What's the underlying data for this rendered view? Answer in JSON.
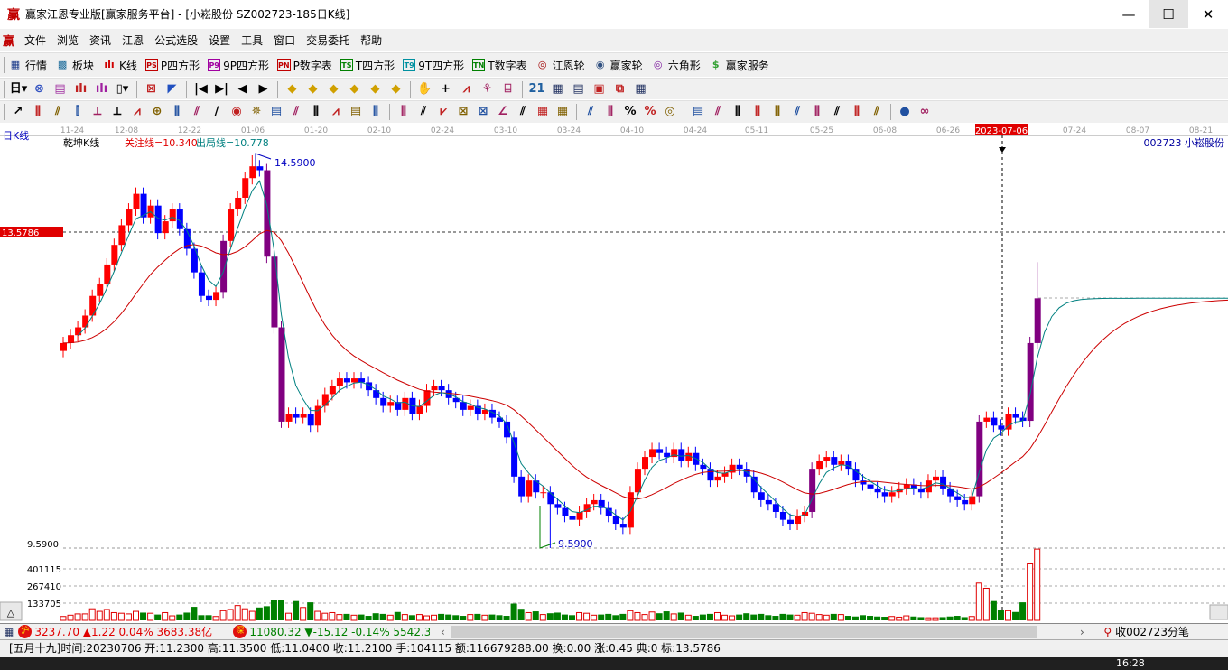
{
  "window": {
    "title": "赢家江恩专业版[赢家服务平台] - [小崧股份  SZ002723-185日K线]",
    "logo": "赢"
  },
  "menu": [
    "文件",
    "浏览",
    "资讯",
    "江恩",
    "公式选股",
    "设置",
    "工具",
    "窗口",
    "交易委托",
    "帮助"
  ],
  "toolbar1": [
    {
      "label": "行情",
      "icon": "▦",
      "color": "#1a3a8a",
      "name": "quote"
    },
    {
      "label": "板块",
      "icon": "▩",
      "color": "#1a6a9a",
      "name": "sector"
    },
    {
      "label": "K线",
      "icon": "ılı",
      "color": "#d00000",
      "name": "kline"
    },
    {
      "label": "P四方形",
      "icon": "PS",
      "color": "#c00000",
      "name": "p-square"
    },
    {
      "label": "9P四方形",
      "icon": "P9",
      "color": "#a000a0",
      "name": "9p-square"
    },
    {
      "label": "P数字表",
      "icon": "PN",
      "color": "#c00000",
      "name": "p-number-table"
    },
    {
      "label": "T四方形",
      "icon": "TS",
      "color": "#008000",
      "name": "t-square"
    },
    {
      "label": "9T四方形",
      "icon": "T9",
      "color": "#0090a0",
      "name": "9t-square"
    },
    {
      "label": "T数字表",
      "icon": "TN",
      "color": "#008000",
      "name": "t-number-table"
    },
    {
      "label": "江恩轮",
      "icon": "◎",
      "color": "#a00000",
      "name": "gann-wheel"
    },
    {
      "label": "赢家轮",
      "icon": "◉",
      "color": "#305080",
      "name": "winner-wheel"
    },
    {
      "label": "六角形",
      "icon": "◎",
      "color": "#8020a0",
      "name": "hexagon"
    },
    {
      "label": "赢家服务",
      "icon": "$",
      "color": "#30a030",
      "name": "winner-service"
    }
  ],
  "toolbar2": [
    {
      "g": "日▾",
      "c": "#000",
      "n": "period-select"
    },
    {
      "g": "⊗",
      "c": "#3050c0",
      "n": "chart-type"
    },
    {
      "g": "▤",
      "c": "#a030a0",
      "n": "list"
    },
    {
      "g": "ılı",
      "c": "#c02020",
      "n": "kline-type"
    },
    {
      "g": "ılı",
      "c": "#a020a0",
      "n": "bar-type"
    },
    {
      "g": "▯▾",
      "c": "#000",
      "n": "candle-select"
    },
    {
      "g": "⊠",
      "c": "#c02020",
      "n": "indicator"
    },
    {
      "g": "◤",
      "c": "#2050c0",
      "n": "overlay"
    },
    {
      "g": "|◀",
      "c": "#000",
      "n": "first"
    },
    {
      "g": "▶|",
      "c": "#000",
      "n": "last"
    },
    {
      "g": "◀",
      "c": "#000",
      "n": "prev"
    },
    {
      "g": "▶",
      "c": "#000",
      "n": "next"
    },
    {
      "g": "◆",
      "c": "#d0a000",
      "n": "zoom-1"
    },
    {
      "g": "◆",
      "c": "#d0a000",
      "n": "zoom-2"
    },
    {
      "g": "◆",
      "c": "#d0a000",
      "n": "zoom-3"
    },
    {
      "g": "◆",
      "c": "#d0a000",
      "n": "zoom-4"
    },
    {
      "g": "◆",
      "c": "#d0a000",
      "n": "zoom-5"
    },
    {
      "g": "◆",
      "c": "#d0a000",
      "n": "zoom-6"
    },
    {
      "g": "✋",
      "c": "#000",
      "n": "pan"
    },
    {
      "g": "+",
      "c": "#000",
      "n": "crosshair"
    },
    {
      "g": "⩘",
      "c": "#c02020",
      "n": "line-draw"
    },
    {
      "g": "⚘",
      "c": "#a02060",
      "n": "pattern"
    },
    {
      "g": "⌸",
      "c": "#a02060",
      "n": "tool"
    },
    {
      "g": "21",
      "c": "#2060a0",
      "n": "calendar"
    },
    {
      "g": "▦",
      "c": "#203060",
      "n": "calc"
    },
    {
      "g": "▤",
      "c": "#203060",
      "n": "report"
    },
    {
      "g": "▣",
      "c": "#c02020",
      "n": "save"
    },
    {
      "g": "⧉",
      "c": "#c02020",
      "n": "copy"
    },
    {
      "g": "▦",
      "c": "#203060",
      "n": "print"
    }
  ],
  "toolbar3": [
    "↗",
    "⫼",
    "⫽",
    "⫿",
    "⟂",
    "⟂",
    "⩘",
    "⊕",
    "⫼",
    "⫽",
    "∕",
    "◉",
    "✵",
    "▤",
    "⫽",
    "⫼",
    "⩘",
    "▤",
    "⫼",
    "⫼",
    "⫽",
    "⩗",
    "⊠",
    "⊠",
    "∠",
    "⫽",
    "▦",
    "▦",
    "⫽",
    "⫼",
    "%",
    "%",
    "◎",
    "▤",
    "⫽",
    "⫼",
    "⫼",
    "⫼",
    "⫽",
    "⫼",
    "⫽",
    "⫼",
    "⫽",
    "●",
    "∞"
  ],
  "chart": {
    "period_label": "日K线",
    "indicator_name": "乾坤K线",
    "focus_line": "关注线=10.340",
    "exit_line": "出局线=10.778",
    "stock_label": "002723  小崧股份",
    "date_ticks": [
      "11-24",
      "12-08",
      "12-22",
      "01-06",
      "01-20",
      "02-10",
      "02-24",
      "03-10",
      "03-24",
      "04-10",
      "04-24",
      "05-11",
      "05-25",
      "06-08",
      "06-26",
      "07-24",
      "08-07",
      "08-21"
    ],
    "cursor_date": "2023-07-06",
    "cursor_price": "13.5786",
    "high_label": "14.5900",
    "low_label": "9.5900",
    "low_axis_label": "9.5900",
    "volume_axis": [
      "401115",
      "267410",
      "133705"
    ],
    "collapse_button": "△"
  },
  "chart_data": {
    "type": "candlestick",
    "price_range": [
      9.59,
      14.59
    ],
    "volume_axis_values": [
      133705,
      267410,
      401115
    ],
    "closes": [
      12.2,
      12.3,
      12.4,
      12.55,
      12.8,
      12.95,
      13.2,
      13.45,
      13.7,
      13.9,
      14.1,
      13.8,
      13.95,
      13.6,
      13.75,
      13.9,
      13.65,
      13.4,
      13.1,
      12.8,
      12.75,
      12.85,
      13.5,
      13.9,
      14.05,
      14.3,
      14.45,
      14.4,
      13.3,
      12.4,
      11.2,
      11.3,
      11.25,
      11.3,
      11.15,
      11.4,
      11.55,
      11.65,
      11.75,
      11.7,
      11.75,
      11.7,
      11.6,
      11.5,
      11.4,
      11.45,
      11.35,
      11.5,
      11.3,
      11.4,
      11.6,
      11.65,
      11.6,
      11.5,
      11.45,
      11.35,
      11.4,
      11.3,
      11.35,
      11.25,
      11.2,
      11.0,
      10.5,
      10.25,
      10.45,
      10.3,
      10.3,
      10.15,
      10.1,
      10.0,
      9.95,
      10.05,
      10.15,
      10.2,
      10.1,
      10.0,
      9.9,
      9.85,
      10.3,
      10.6,
      10.75,
      10.85,
      10.8,
      10.75,
      10.85,
      10.7,
      10.8,
      10.65,
      10.6,
      10.45,
      10.5,
      10.55,
      10.65,
      10.6,
      10.5,
      10.3,
      10.2,
      10.15,
      10.05,
      9.95,
      9.9,
      10.0,
      10.05,
      10.6,
      10.7,
      10.75,
      10.65,
      10.7,
      10.6,
      10.45,
      10.4,
      10.35,
      10.3,
      10.25,
      10.3,
      10.35,
      10.4,
      10.35,
      10.3,
      10.45,
      10.5,
      10.35,
      10.25,
      10.2,
      10.15,
      10.25,
      11.2,
      11.25,
      11.15,
      11.1,
      11.3,
      11.25,
      11.21,
      12.2,
      12.77
    ],
    "first_open": 12.1,
    "extremes": {
      "high": {
        "index": 26,
        "value": 14.59
      },
      "low": {
        "index": 67,
        "value": 9.59
      },
      "last_high": 13.23
    },
    "volumes_k": [
      30,
      40,
      50,
      50,
      90,
      70,
      85,
      60,
      55,
      50,
      70,
      60,
      55,
      45,
      60,
      35,
      45,
      60,
      105,
      40,
      40,
      30,
      75,
      85,
      115,
      90,
      70,
      100,
      110,
      155,
      160,
      55,
      150,
      100,
      140,
      70,
      55,
      60,
      45,
      50,
      40,
      45,
      35,
      55,
      50,
      40,
      65,
      45,
      40,
      45,
      35,
      40,
      50,
      45,
      40,
      35,
      45,
      50,
      40,
      45,
      40,
      35,
      130,
      90,
      60,
      70,
      45,
      55,
      60,
      45,
      40,
      60,
      55,
      40,
      45,
      50,
      40,
      50,
      75,
      60,
      45,
      65,
      55,
      70,
      50,
      60,
      40,
      35,
      45,
      50,
      60,
      40,
      35,
      45,
      55,
      45,
      50,
      40,
      35,
      50,
      45,
      40,
      60,
      55,
      45,
      40,
      50,
      45,
      35,
      30,
      40,
      35,
      30,
      28,
      30,
      25,
      35,
      30,
      25,
      20,
      20,
      25,
      30,
      35,
      25,
      30,
      290,
      250,
      150,
      80,
      75,
      65,
      140,
      440,
      555
    ],
    "cursor_index": 129,
    "colors": {
      "up": "#ff0000",
      "down": "#0000ff",
      "ma_short": "#008080",
      "ma_long": "#cc0000",
      "vol_down": "#008000"
    }
  },
  "bottombar": {
    "sh_badge": "沪",
    "sh_text": "3237.70 ▲1.22 0.04% 3683.38亿",
    "sz_badge": "深",
    "sz_text": "11080.32 ▼-15.12 -0.14% 5542.38",
    "tick_label": "收002723分笔"
  },
  "status": "[五月十九]时间:20230706 开:11.2300 高:11.3500 低:11.0400 收:11.2100 手:104115 额:116679288.00 换:0.00 涨:0.45 典:0 标:13.5786",
  "taskbar": {
    "clock": "16:28"
  }
}
